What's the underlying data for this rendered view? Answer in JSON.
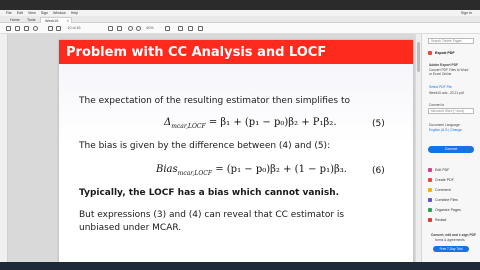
{
  "menu": [
    "File",
    "Edit",
    "View",
    "Sign",
    "Window",
    "Help"
  ],
  "signin": "Sign In",
  "tabs": {
    "home": "Home",
    "tools": "Tools",
    "doc": "Week10-advice_m...",
    "doc_close": "×"
  },
  "toolbar": {
    "page": "10 of 45",
    "zoom": "60%"
  },
  "slide": {
    "title": "Problem with CC Analysis and LOCF",
    "p1": "The expectation of the resulting estimator then simplifies to",
    "eq1": "Δ",
    "eq1_sub": "mcar,LOCF",
    "eq1_rhs": " = β₁ + (p₁ − p₀)β₂ + P₁β₂.",
    "eq1_no": "(5)",
    "p2": "The bias is given by the difference between (4) and (5):",
    "eq2": "Bias",
    "eq2_sub": "mcar,LOCF",
    "eq2_rhs": " = (p₁ − p₀)β₂ + (1 − p₁)β₃.",
    "eq2_no": "(6)",
    "p3": "Typically, the LOCF has a bias which cannot vanish.",
    "p4a": "But expressions (3) and (4) can reveal that CC estimator is",
    "p4b": "unbiased under MCAR."
  },
  "panel": {
    "search": "Search 'Delete Pages'",
    "export_title": "Export PDF",
    "export_sub1": "Adobe Export PDF",
    "export_sub2": "Convert PDF Files to Word",
    "export_sub3": "or Excel Online",
    "select_file": "Select PDF File",
    "file_name": "Week10-adv...20.21.pdf",
    "convert_to": "Convert to",
    "format": "Microsoft Word (*.docx)",
    "doc_lang": "Document Language:",
    "lang": "English (U.S.) Change",
    "convert_btn": "Convert",
    "tools": [
      "Edit PDF",
      "Create PDF",
      "Comment",
      "Combine Files",
      "Organize Pages",
      "Redact"
    ],
    "promo1": "Convert, edit and e-sign PDF",
    "promo2": "forms & agreements",
    "trial": "Free 7-Day Trial"
  },
  "colors": {
    "accent": "#ff2a1e",
    "adobe_blue": "#1473e6"
  }
}
